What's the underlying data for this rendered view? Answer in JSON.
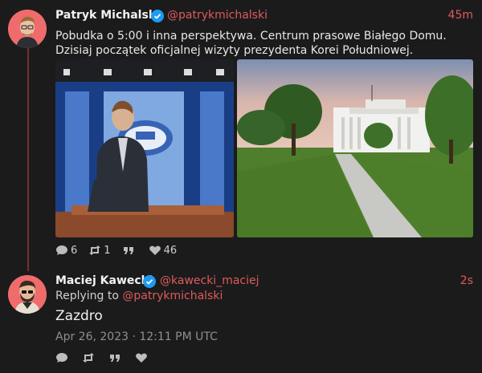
{
  "tweet1": {
    "display_name": "Patryk Michalski",
    "handle": "@patrykmichalski",
    "time": "45m",
    "text": "Pobudka o 5:00 i inna perspektywa. Centrum prasowe Białego Domu. Dzisiaj początek oficjalnej wizyty prezydenta Korei Południowej.",
    "media": [
      {
        "icon": "press-room-photo"
      },
      {
        "icon": "white-house-lawn-photo"
      }
    ],
    "actions": {
      "replies": "6",
      "retweets": "1",
      "quotes": "",
      "likes": "46"
    }
  },
  "tweet2": {
    "display_name": "Maciej Kawecki",
    "handle": "@kawecki_maciej",
    "time": "2s",
    "replying_label": "Replying to",
    "replying_handle": "@patrykmichalski",
    "text": "Zazdro",
    "date": "Apr 26, 2023 · 12:11 PM UTC"
  },
  "colors": {
    "background": "#1b1b1c",
    "accent": "#e05a5a",
    "verified": "#1d9bf0"
  }
}
